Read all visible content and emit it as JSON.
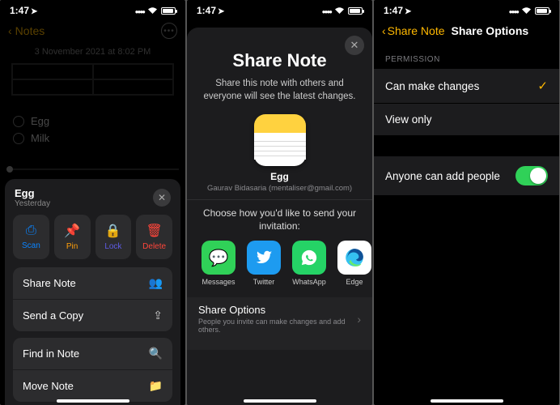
{
  "status": {
    "time": "1:47",
    "loc_arrow": "➤"
  },
  "screen1": {
    "back_label": "Notes",
    "date": "3 November 2021 at 8:02 PM",
    "items": [
      "Egg",
      "Milk"
    ],
    "sheet": {
      "title": "Egg",
      "subtitle": "Yesterday",
      "actions": [
        {
          "label": "Scan",
          "icon": "⎙"
        },
        {
          "label": "Pin",
          "icon": "📌"
        },
        {
          "label": "Lock",
          "icon": "🔒"
        },
        {
          "label": "Delete",
          "icon": "🗑"
        }
      ],
      "menu1": [
        {
          "label": "Share Note",
          "icon": "👥"
        },
        {
          "label": "Send a Copy",
          "icon": "⇪"
        }
      ],
      "menu2": [
        {
          "label": "Find in Note",
          "icon": "🔍"
        },
        {
          "label": "Move Note",
          "icon": "📁"
        }
      ]
    }
  },
  "screen2": {
    "title": "Share Note",
    "desc": "Share this note with others and everyone will see the latest changes.",
    "note_name": "Egg",
    "note_owner": "Gaurav Bidasaria (mentaliser@gmail.com)",
    "invite": "Choose how you'd like to send your invitation:",
    "apps": [
      "Messages",
      "Twitter",
      "WhatsApp",
      "Edge"
    ],
    "options_title": "Share Options",
    "options_sub": "People you invite can make changes and add others."
  },
  "screen3": {
    "back": "Share Note",
    "title": "Share Options",
    "section": "PERMISSION",
    "perm_changes": "Can make changes",
    "perm_view": "View only",
    "anyone": "Anyone can add people"
  }
}
